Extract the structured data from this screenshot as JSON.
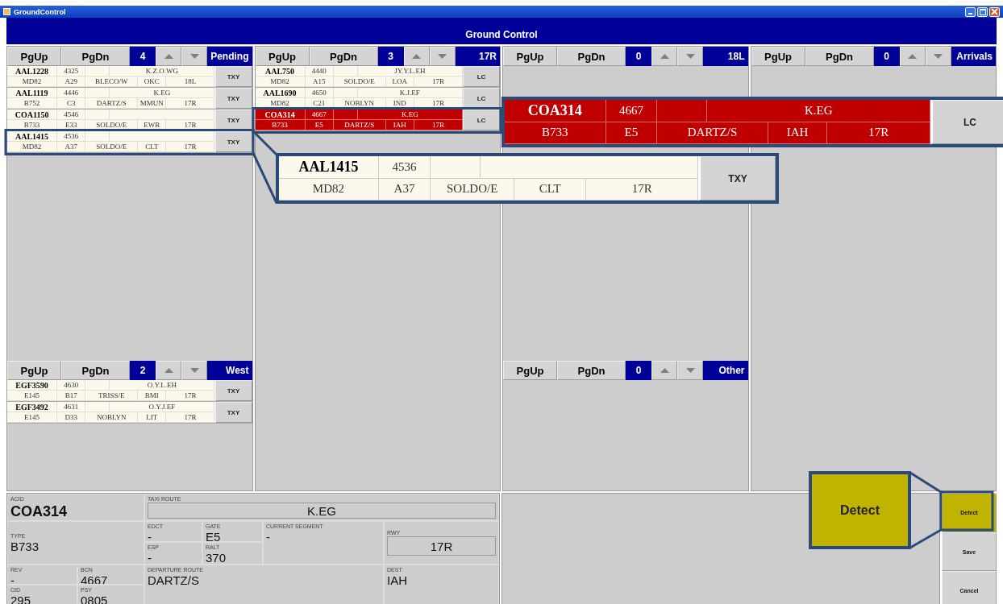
{
  "window": {
    "title": "GroundControl",
    "header": "Ground Control"
  },
  "columns": [
    {
      "lists": [
        {
          "page_up": "PgUp",
          "page_down": "PgDn",
          "count": "4",
          "name": "Pending",
          "rows": [
            {
              "acid": "AAL1228",
              "bcn": "4325",
              "route": "K.Z.O.WG",
              "type": "MD82",
              "gate": "A29",
              "departure": "BLECO/W",
              "dest": "OKC",
              "rwy": "18L",
              "button": "TXY",
              "selected": false
            },
            {
              "acid": "AAL1119",
              "bcn": "4446",
              "route": "K.EG",
              "type": "B752",
              "gate": "C3",
              "departure": "DARTZ/S",
              "dest": "MMUN",
              "rwy": "17R",
              "button": "TXY",
              "selected": false
            },
            {
              "acid": "COA1150",
              "bcn": "4546",
              "type": "B733",
              "gate": "E33",
              "departure": "SOLDO/E",
              "dest": "EWR",
              "rwy": "17R",
              "button": "TXY",
              "selected": false
            },
            {
              "acid": "AAL1415",
              "bcn": "4536",
              "type": "MD82",
              "gate": "A37",
              "departure": "SOLDO/E",
              "dest": "CLT",
              "rwy": "17R",
              "button": "TXY",
              "selected": false
            }
          ]
        },
        {
          "page_up": "PgUp",
          "page_down": "PgDn",
          "count": "2",
          "name": "West",
          "rows": [
            {
              "acid": "EGF3590",
              "bcn": "4630",
              "route": "O.Y.L.EH",
              "type": "E145",
              "gate": "B17",
              "departure": "TRISS/E",
              "dest": "BMI",
              "rwy": "17R",
              "button": "TXY",
              "selected": false
            },
            {
              "acid": "EGF3492",
              "bcn": "4631",
              "route": "O.Y.J.EF",
              "type": "E145",
              "gate": "D33",
              "departure": "NOBLYN",
              "dest": "LIT",
              "rwy": "17R",
              "button": "TXY",
              "selected": false
            }
          ]
        }
      ]
    },
    {
      "lists": [
        {
          "page_up": "PgUp",
          "page_down": "PgDn",
          "count": "3",
          "name": "17R",
          "rows": [
            {
              "acid": "AAL750",
              "bcn": "4440",
              "route": "JY.Y.L.EH",
              "type": "MD82",
              "gate": "A15",
              "departure": "SOLDO/E",
              "dest": "LOA",
              "rwy": "17R",
              "button": "LC",
              "selected": false
            },
            {
              "acid": "AAL1690",
              "bcn": "4650",
              "route": "K.J.EF",
              "type": "MD82",
              "gate": "C21",
              "departure": "NOBLYN",
              "dest": "IND",
              "rwy": "17R",
              "button": "LC",
              "selected": false
            },
            {
              "acid": "COA314",
              "bcn": "4667",
              "route": "K.EG",
              "type": "B733",
              "gate": "E5",
              "departure": "DARTZ/S",
              "dest": "IAH",
              "rwy": "17R",
              "button": "LC",
              "selected": true
            }
          ]
        }
      ]
    },
    {
      "lists": [
        {
          "page_up": "PgUp",
          "page_down": "PgDn",
          "count": "0",
          "name": "18L"
        },
        {
          "page_up": "PgUp",
          "page_down": "PgDn",
          "count": "0",
          "name": "Other"
        }
      ]
    },
    {
      "lists": [
        {
          "page_up": "PgUp",
          "page_down": "PgDn",
          "count": "0",
          "name": "Arrivals"
        }
      ]
    }
  ],
  "details": {
    "acid": {
      "label": "ACID",
      "value": "COA314"
    },
    "taxi": {
      "label": "TAXI ROUTE",
      "value": "K.EG"
    },
    "type": {
      "label": "TYPE",
      "value": "B733"
    },
    "edct": {
      "label": "EDCT",
      "value": "-"
    },
    "gate": {
      "label": "GATE",
      "value": "E5"
    },
    "segment": {
      "label": "CURRENT SEGMENT",
      "value": "-"
    },
    "rwy": {
      "label": "RWY",
      "value": "17R"
    },
    "esp": {
      "label": "ESP",
      "value": "-"
    },
    "ralt": {
      "label": "RALT",
      "value": "370"
    },
    "rev": {
      "label": "REV",
      "value": "-"
    },
    "bcn": {
      "label": "BCN",
      "value": "4667"
    },
    "dep": {
      "label": "DEPARTURE ROUTE",
      "value": "DARTZ/S"
    },
    "dest": {
      "label": "DEST",
      "value": "IAH"
    },
    "cid": {
      "label": "CID",
      "value": "295"
    },
    "psy": {
      "label": "PSY",
      "value": "0805"
    }
  },
  "buttons": [
    {
      "label": "Detect",
      "selected": true
    },
    {
      "label": "Save",
      "selected": false
    },
    {
      "label": "Cancel",
      "selected": false
    }
  ],
  "callouts": [
    {
      "kind": "row",
      "row": {
        "acid": "AAL1415",
        "bcn": "4536",
        "type": "MD82",
        "gate": "A37",
        "departure": "SOLDO/E",
        "dest": "CLT",
        "rwy": "17R",
        "button": "TXY",
        "selected": false
      }
    },
    {
      "kind": "row",
      "row": {
        "acid": "COA314",
        "bcn": "4667",
        "route": "K.EG",
        "type": "B733",
        "gate": "E5",
        "departure": "DARTZ/S",
        "dest": "IAH",
        "rwy": "17R",
        "button": "LC",
        "selected": true
      }
    },
    {
      "kind": "button",
      "label": "Detect",
      "selected": true
    }
  ]
}
